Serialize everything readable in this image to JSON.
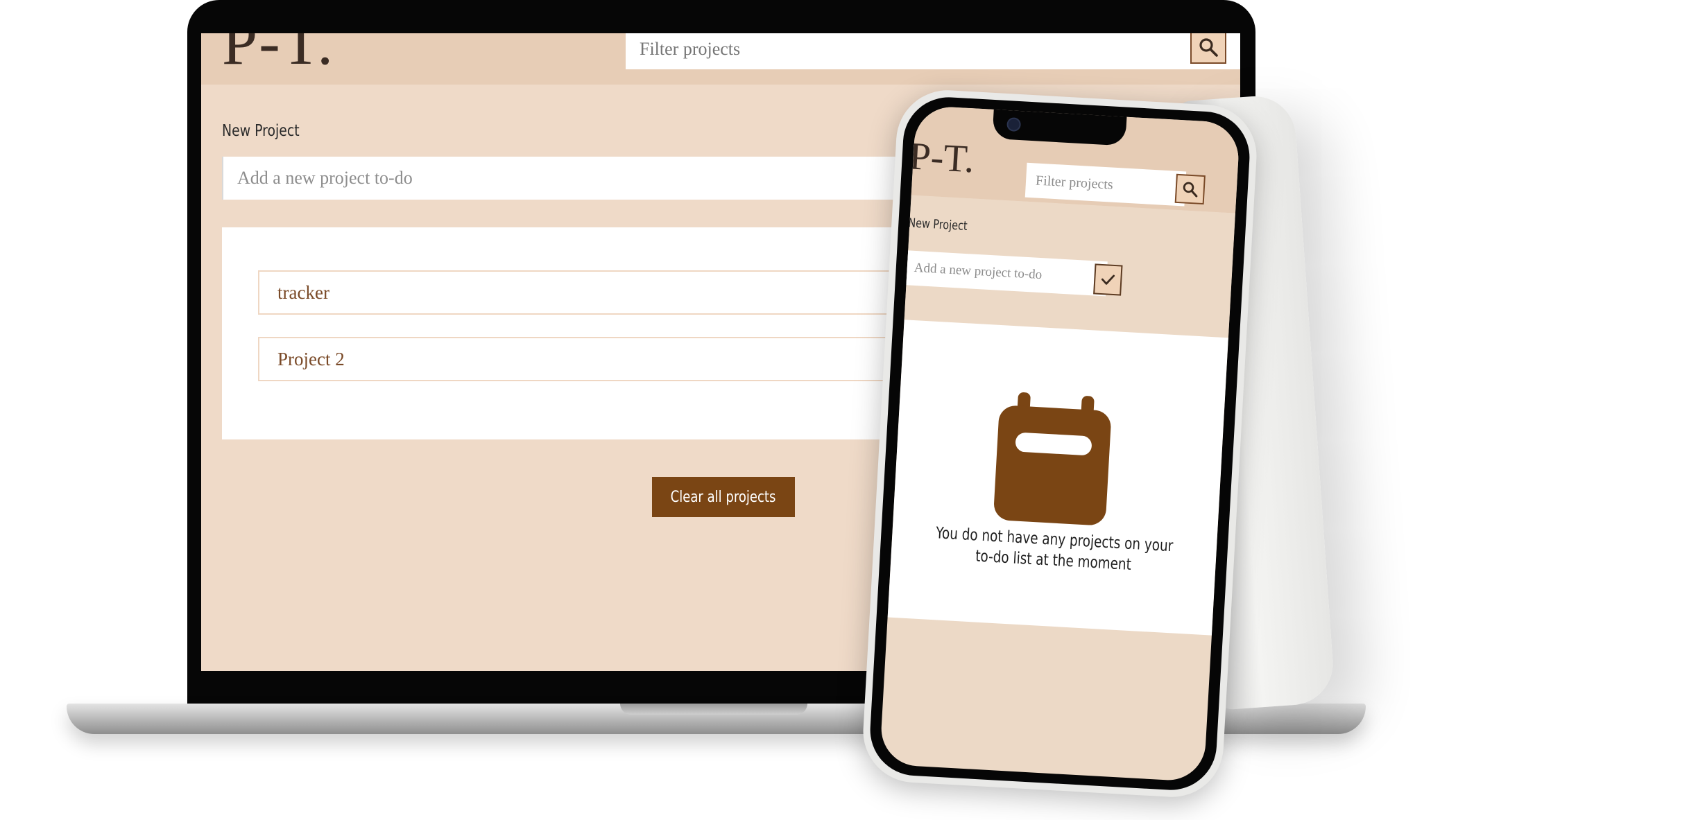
{
  "laptop": {
    "logo": "P-T.",
    "filter_placeholder": "Filter projects",
    "new_project_label": "New Project",
    "new_project_placeholder": "Add a new project to-do",
    "projects": [
      "tracker",
      "Project 2"
    ],
    "clear_button": "Clear all projects"
  },
  "phone": {
    "logo": "P-T.",
    "filter_placeholder": "Filter projects",
    "new_project_label": "New Project",
    "new_project_placeholder": "Add a new project to-do",
    "empty_message": "You do not have any projects on your to-do list at the moment"
  },
  "icons": {
    "search": "search-icon",
    "check": "check-icon",
    "empty_state": "calendar-icon"
  },
  "colors": {
    "page_bg": "#efdac8",
    "header_bg": "#e7cdb6",
    "accent_brown": "#7a4514",
    "item_text": "#7a4a28",
    "button_bg": "#f0d3b8"
  }
}
